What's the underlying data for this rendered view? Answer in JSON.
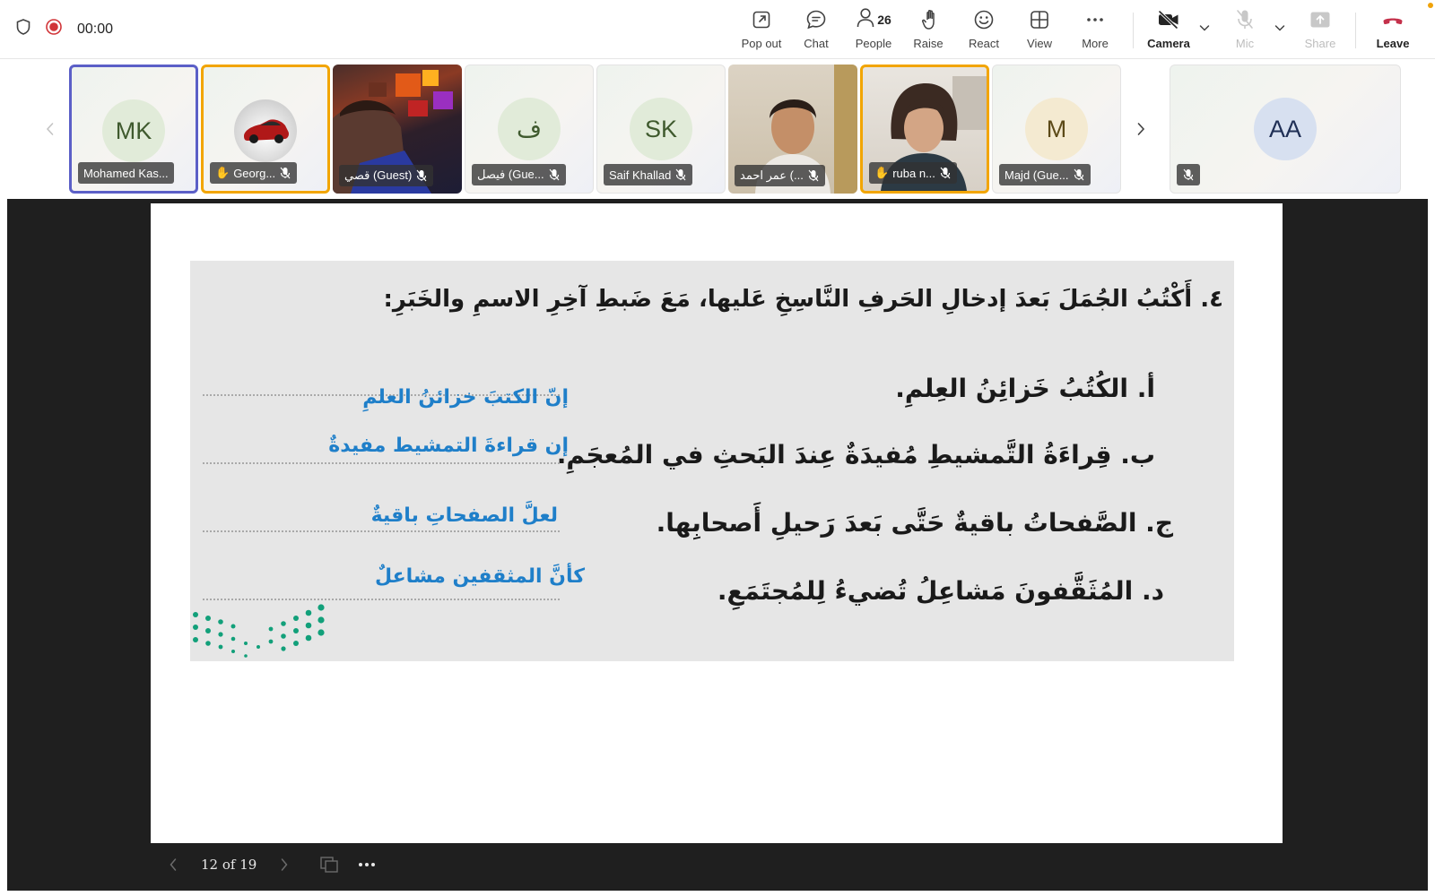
{
  "toolbar": {
    "timer": "00:00",
    "buttons": {
      "popout": "Pop out",
      "chat": "Chat",
      "people": "People",
      "people_count": "26",
      "raise": "Raise",
      "react": "React",
      "view": "View",
      "more": "More",
      "camera": "Camera",
      "mic": "Mic",
      "share": "Share",
      "leave": "Leave"
    },
    "colors": {
      "record": "#d13438",
      "leave": "#c4314b",
      "accent": "#5b5fc7",
      "raised_hand": "#f2a500"
    }
  },
  "participants": [
    {
      "initials": "MK",
      "name": "Mohamed Kas...",
      "state": "active-speaker",
      "avatar_color": "#e1ebd9",
      "initials_color": "#3f5a2e"
    },
    {
      "initials": "",
      "name": "Georg...",
      "state": "raised",
      "hand": "✋",
      "image": "red-car-photo"
    },
    {
      "initials": "",
      "name": "قصي (Guest)",
      "state": "video",
      "image": "game-screen-video"
    },
    {
      "initials": "ف",
      "name": "فيصل (Gue...",
      "state": "",
      "avatar_color": "#e1ebd9",
      "initials_color": "#3f5a2e"
    },
    {
      "initials": "SK",
      "name": "Saif Khallad",
      "state": "",
      "avatar_color": "#e1ebd9",
      "initials_color": "#3f5a2e"
    },
    {
      "initials": "",
      "name": "عمر احمد (...",
      "state": "video",
      "image": "boy-camera-video"
    },
    {
      "initials": "",
      "name": "ruba n...",
      "state": "raised",
      "hand": "✋",
      "image": "girl-camera-video"
    },
    {
      "initials": "M",
      "name": "Majd (Gue...",
      "state": "",
      "avatar_color": "#f4ead1",
      "initials_color": "#5c4a18"
    },
    {
      "initials": "AA",
      "name": "",
      "state": "",
      "avatar_color": "#d7e0f0",
      "initials_color": "#1f2f55"
    }
  ],
  "slide": {
    "title": "٤. أَكْتُبُ الجُمَلَ بَعدَ إدخالِ الحَرفِ النَّاسِخِ عَليها، مَعَ ضَبطِ آخِرِ الاسمِ والخَبَرِ:",
    "rows": [
      {
        "question": "أ. الكُتُبُ خَزائِنُ العِلمِ.",
        "answer": "إنّ الكتبَ خزائنُ العلمِ"
      },
      {
        "question": "ب. قِراءَةُ التَّمشيطِ مُفيدَةٌ عِندَ البَحثِ في المُعجَمِ.",
        "answer": "إن قراءةَ التمشيط مفيدةٌ"
      },
      {
        "question": "ج. الصَّفحاتُ باقيةٌ حَتَّى بَعدَ رَحيلِ أَصحابِها.",
        "answer": "لعلَّ الصفحاتِ باقيةٌ"
      },
      {
        "question": "د. المُثَقَّفونَ مَشاعِلُ تُضيءُ لِلمُجتَمَعِ.",
        "answer": "كأنَّ المثقفين مشاعلٌ"
      }
    ],
    "colors": {
      "answer": "#1f7fc9",
      "panel": "#e6e6e6",
      "decor": "#12a07a"
    }
  },
  "slide_nav": {
    "page": "12 of 19"
  }
}
